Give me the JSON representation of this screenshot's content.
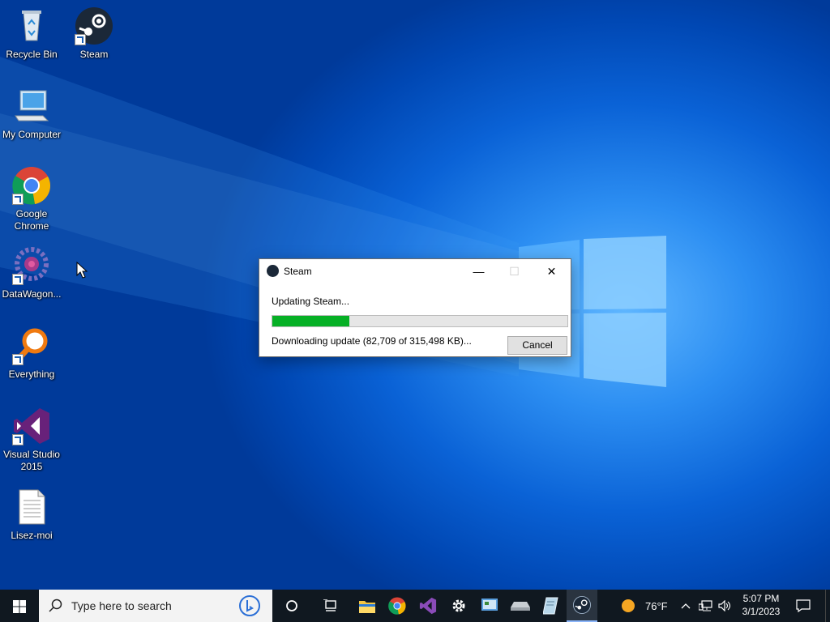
{
  "desktop": {
    "icons": [
      {
        "label": "Recycle Bin",
        "icon": "recycle-bin-icon"
      },
      {
        "label": "Steam",
        "icon": "steam-icon"
      },
      {
        "label": "My Computer",
        "icon": "computer-icon"
      },
      {
        "label": "Google Chrome",
        "icon": "chrome-icon"
      },
      {
        "label": "DataWagon...",
        "icon": "datawagon-icon"
      },
      {
        "label": "Everything",
        "icon": "everything-search-icon"
      },
      {
        "label": "Visual Studio 2015",
        "icon": "visual-studio-icon"
      },
      {
        "label": "Lisez-moi",
        "icon": "text-document-icon"
      }
    ]
  },
  "dialog": {
    "title": "Steam",
    "status": "Updating Steam...",
    "progress": 0.262,
    "detail": "Downloading update (82,709 of 315,498 KB)...",
    "cancel_label": "Cancel",
    "minimize_glyph": "—",
    "maximize_glyph": "☐",
    "close_glyph": "✕"
  },
  "taskbar": {
    "search_placeholder": "Type here to search",
    "apps": [
      "cortana-icon",
      "task-view-icon",
      "file-explorer-icon",
      "chrome-icon",
      "visual-studio-icon",
      "settings-gear-icon",
      "control-panel-icon",
      "drive-icon",
      "notepad-icon",
      "steam-icon"
    ],
    "weather": "76°F",
    "time": "5:07 PM",
    "date": "3/1/2023"
  },
  "colors": {
    "progress_fill": "#06b025",
    "taskbar": "#101820",
    "desktop_blue": "#0a62d6"
  }
}
